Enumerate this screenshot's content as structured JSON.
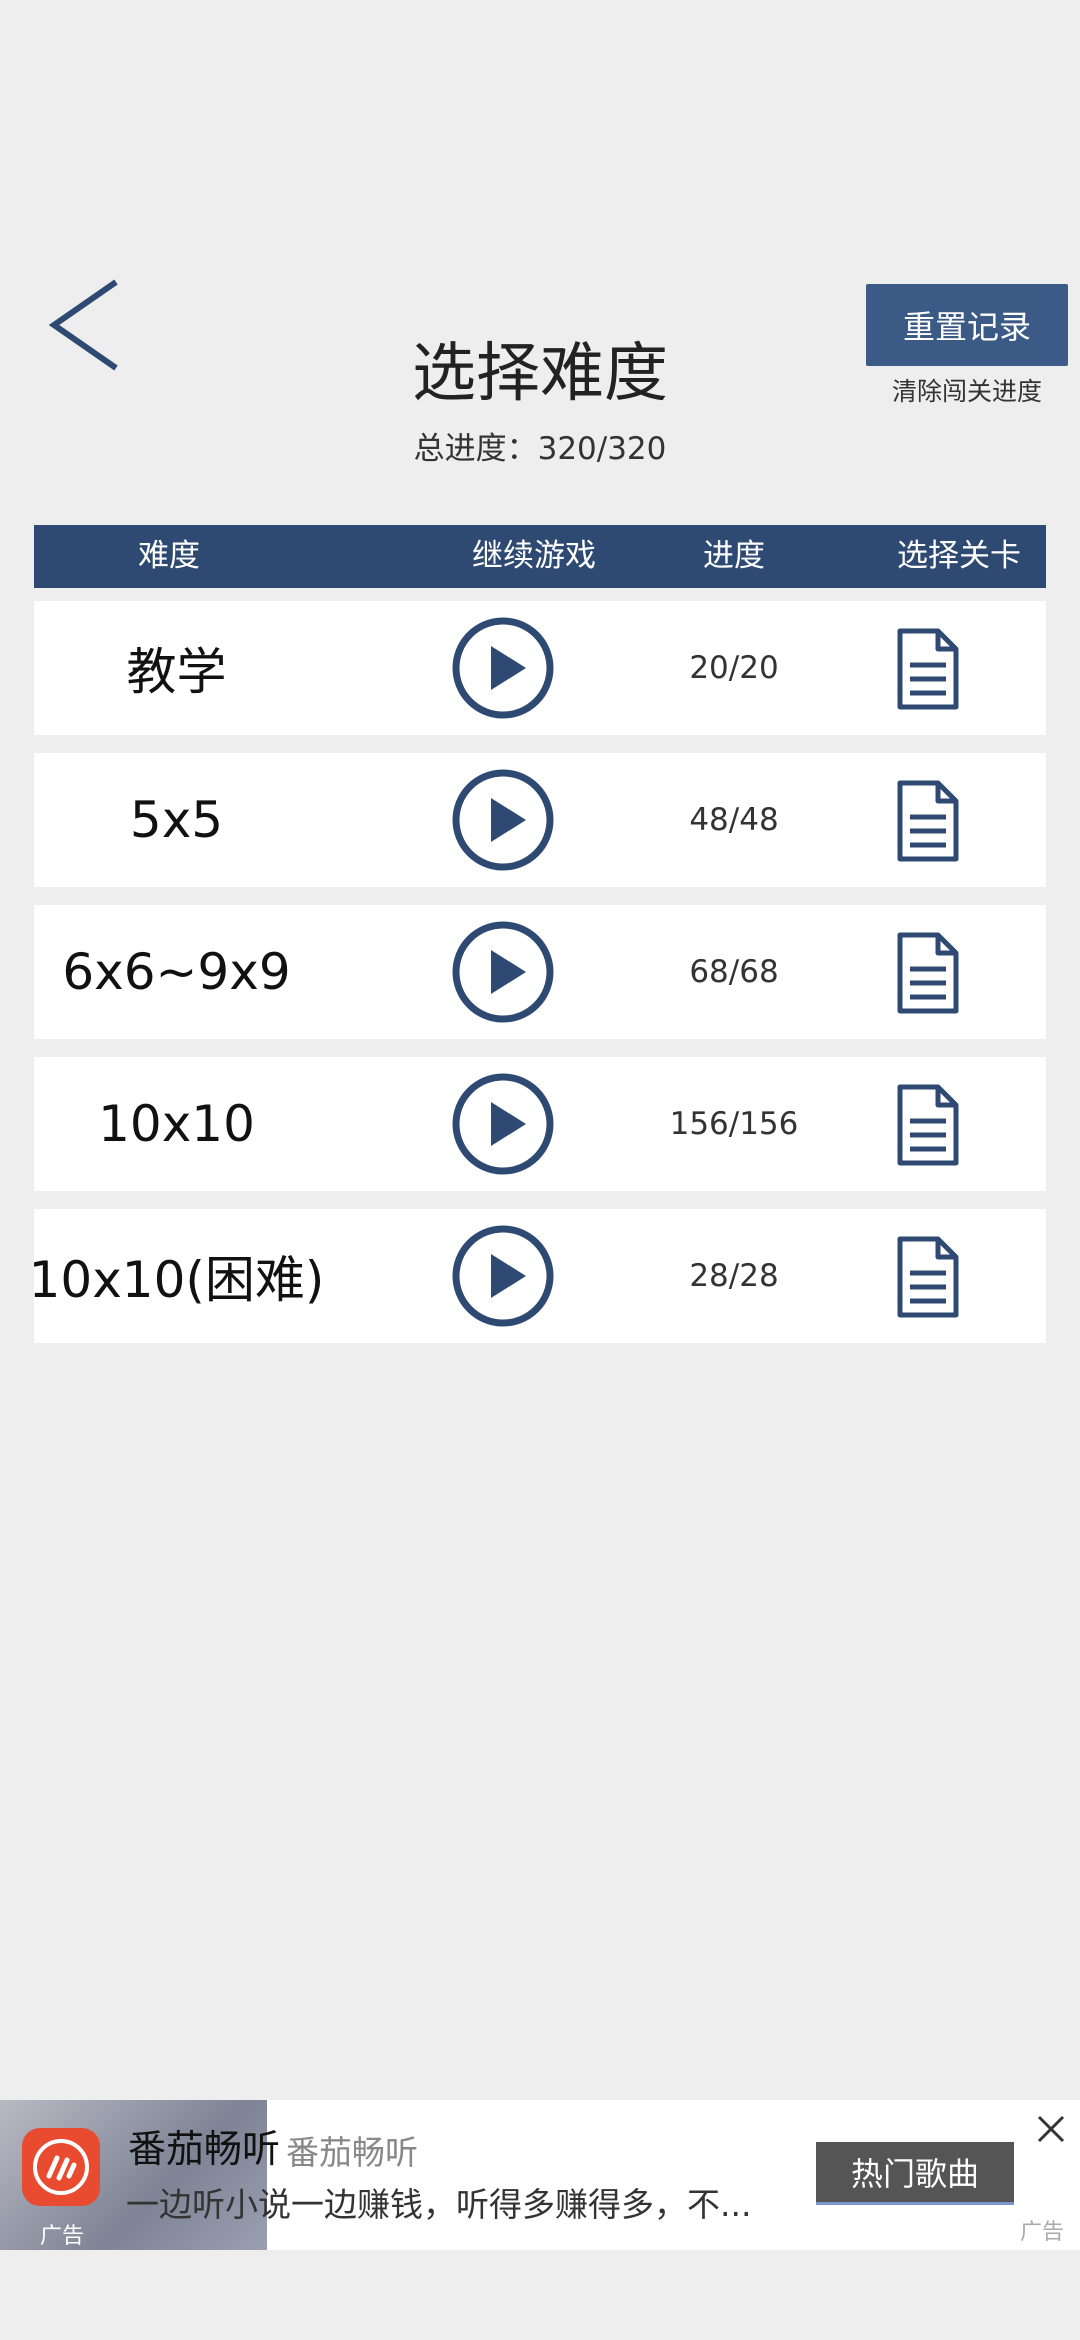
{
  "header": {
    "title": "选择难度",
    "total_progress": "总进度：320/320",
    "reset_button": "重置记录",
    "reset_note": "清除闯关进度"
  },
  "table": {
    "columns": [
      "难度",
      "继续游戏",
      "进度",
      "选择关卡"
    ],
    "rows": [
      {
        "name": "教学",
        "progress": "20/20"
      },
      {
        "name": "5x5",
        "progress": "48/48"
      },
      {
        "name": "6x6~9x9",
        "progress": "68/68"
      },
      {
        "name": "10x10",
        "progress": "156/156"
      },
      {
        "name": "10x10(困难)",
        "progress": "28/28"
      }
    ]
  },
  "ad": {
    "title": "番茄畅听",
    "title_secondary": "番茄畅听",
    "description": "一边听小说一边赚钱，听得多赚得多，不...",
    "cta": "热门歌曲",
    "label": "广告",
    "label_left": "广告"
  },
  "colors": {
    "accent": "#2e4a72",
    "button": "#3b5a86",
    "background": "#eeeeee"
  }
}
